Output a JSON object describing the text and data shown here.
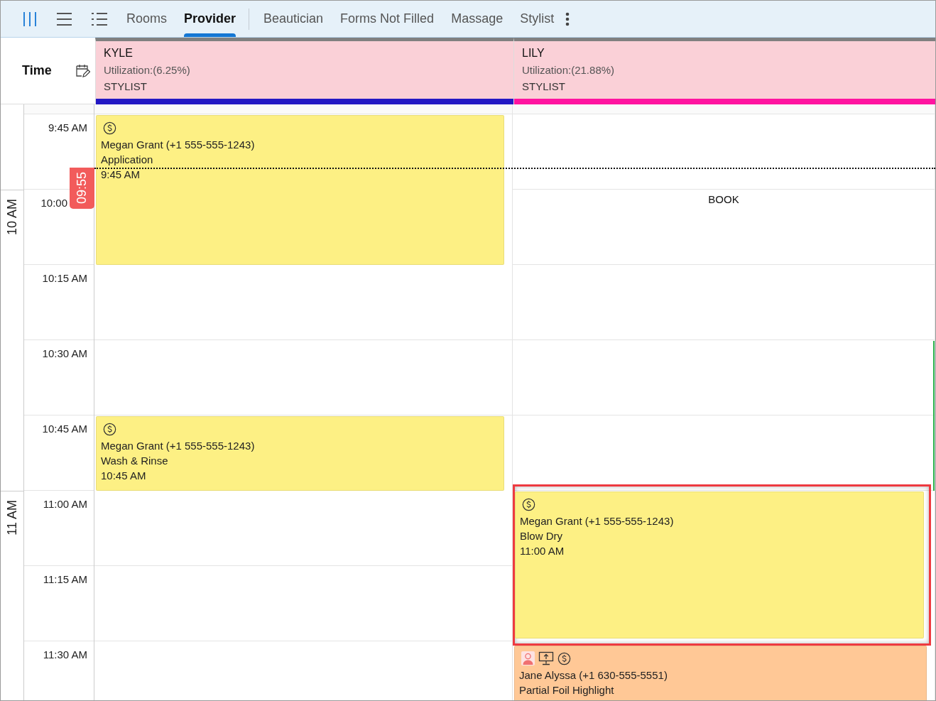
{
  "toolbar": {
    "view_buttons": [
      {
        "kind": "columns",
        "selected": true
      },
      {
        "kind": "lines",
        "selected": false
      },
      {
        "kind": "bullets",
        "selected": false
      }
    ],
    "main_tabs": [
      {
        "label": "Rooms",
        "selected": false
      },
      {
        "label": "Provider",
        "selected": true
      }
    ],
    "filter_tabs": [
      {
        "label": "Beautician",
        "selected": false
      },
      {
        "label": "Forms Not Filled",
        "selected": false
      },
      {
        "label": "Massage",
        "selected": false
      },
      {
        "label": "Stylist",
        "selected": false
      }
    ]
  },
  "time_header": {
    "label": "Time"
  },
  "time_slots": [
    {
      "label": "9:45 AM",
      "now": true
    },
    {
      "label": "10:00",
      "now": false
    },
    {
      "label": "10:15 AM",
      "now": false
    },
    {
      "label": "10:30 AM",
      "now": false
    },
    {
      "label": "10:45 AM",
      "now": false
    },
    {
      "label": "11:00 AM",
      "now": false
    },
    {
      "label": "11:15 AM",
      "now": false
    },
    {
      "label": "11:30 AM",
      "now": false
    }
  ],
  "hours": [
    {
      "label": "10 AM"
    },
    {
      "label": "11 AM"
    }
  ],
  "now_marker": {
    "label": "09:55"
  },
  "providers": [
    {
      "name": "KYLE",
      "utilization": "Utilization:(6.25%)",
      "role": "STYLIST",
      "color": "#2318c4",
      "blocks": [
        {
          "kind": "double",
          "color": "#fdf084",
          "selected": false,
          "icons": [
            {
              "kind": "dollar"
            }
          ],
          "client": "Megan Grant (+1 555-555-1243)",
          "service": "Application",
          "time": "9:45 AM"
        },
        {
          "kind": "empty"
        },
        {
          "kind": "empty"
        },
        {
          "kind": "single",
          "color": "#fdf084",
          "selected": false,
          "icons": [
            {
              "kind": "dollar"
            }
          ],
          "client": "Megan Grant (+1 555-555-1243)",
          "service": "Wash & Rinse",
          "time": "10:45 AM"
        },
        {
          "kind": "empty"
        },
        {
          "kind": "empty"
        }
      ]
    },
    {
      "name": "LILY",
      "utilization": "Utilization:(21.88%)",
      "role": "STYLIST",
      "color": "#ff14a0",
      "blocks": [
        {
          "kind": "empty"
        },
        {
          "kind": "book",
          "label": "BOOK"
        },
        {
          "kind": "empty"
        },
        {
          "kind": "empty"
        },
        {
          "kind": "empty"
        },
        {
          "kind": "double",
          "color": "#fdf084",
          "selected": true,
          "icons": [
            {
              "kind": "dollar"
            }
          ],
          "client": "Megan Grant (+1 555-555-1243)",
          "service": "Blow Dry",
          "time": "11:00 AM"
        },
        {
          "kind": "open",
          "color": "#ffc896",
          "selected": false,
          "icons": [
            {
              "kind": "person"
            },
            {
              "kind": "monitor"
            },
            {
              "kind": "dollar"
            }
          ],
          "client": "Jane Alyssa (+1 630-555-5551)",
          "service": "Partial Foil Highlight"
        }
      ]
    }
  ]
}
